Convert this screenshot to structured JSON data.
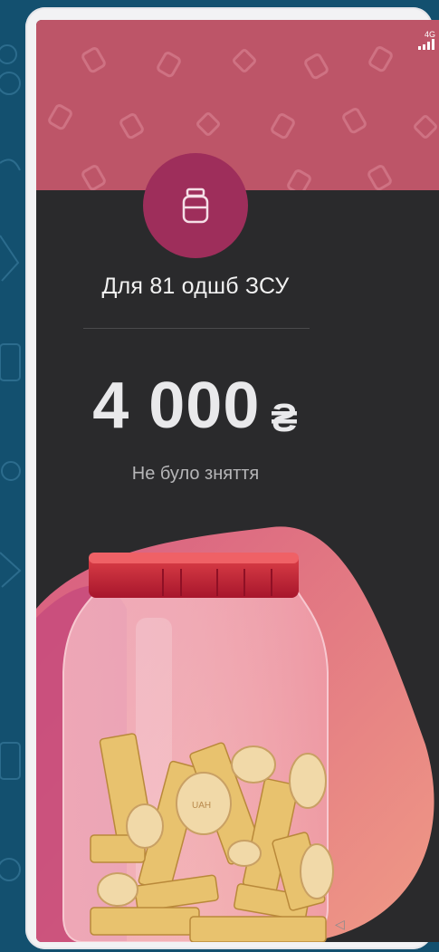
{
  "statusbar": {
    "network": "4G"
  },
  "jar": {
    "title": "Для 81 одшб ЗСУ",
    "amount": "4 000",
    "currency_symbol": "₴",
    "withdrawal_status": "Не було зняття"
  },
  "icons": {
    "header": "jar-icon",
    "nav": "back-triangle-icon"
  },
  "colors": {
    "header_pattern": "#bd5568",
    "avatar": "#9e2e5b",
    "screen_bg": "#2a2a2c",
    "outer_bg": "#13506f"
  }
}
